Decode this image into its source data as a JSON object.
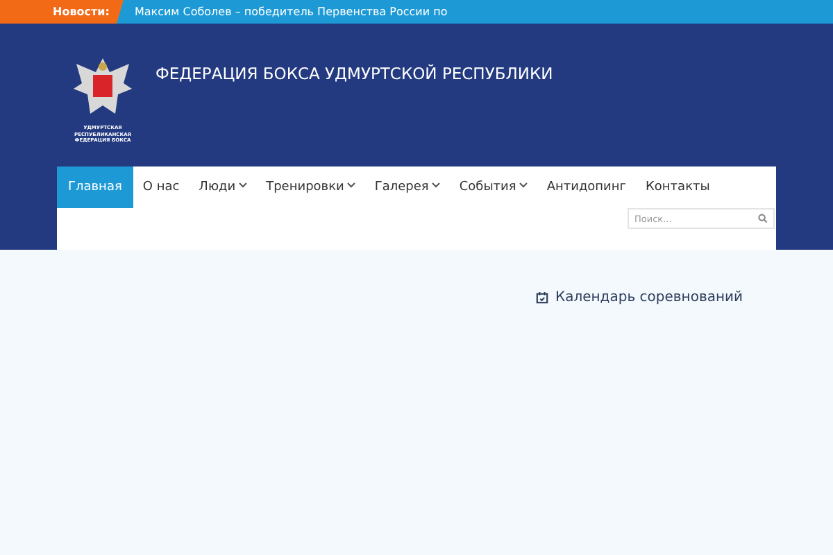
{
  "news_bar": {
    "label": "Новости:",
    "headline": "Максим Соболев – победитель Первенства России по"
  },
  "header": {
    "logo_caption": "УДМУРТСКАЯ РЕСПУБЛИКАНСКАЯ ФЕДЕРАЦИЯ БОКСА",
    "site_title": "ФЕДЕРАЦИЯ БОКСА УДМУРТСКОЙ РЕСПУБЛИКИ"
  },
  "nav": {
    "items": [
      {
        "label": "Главная",
        "selected": true,
        "has_submenu": false
      },
      {
        "label": "О нас",
        "selected": false,
        "has_submenu": false
      },
      {
        "label": "Люди",
        "selected": false,
        "has_submenu": true
      },
      {
        "label": "Тренировки",
        "selected": false,
        "has_submenu": true
      },
      {
        "label": "Галерея",
        "selected": false,
        "has_submenu": true
      },
      {
        "label": "События",
        "selected": false,
        "has_submenu": true
      },
      {
        "label": "Антидопинг",
        "selected": false,
        "has_submenu": false
      },
      {
        "label": "Контакты",
        "selected": false,
        "has_submenu": false
      }
    ],
    "search": {
      "placeholder": "Поиск..."
    }
  },
  "sidebar": {
    "calendar_link": "Календарь соревнований"
  }
}
